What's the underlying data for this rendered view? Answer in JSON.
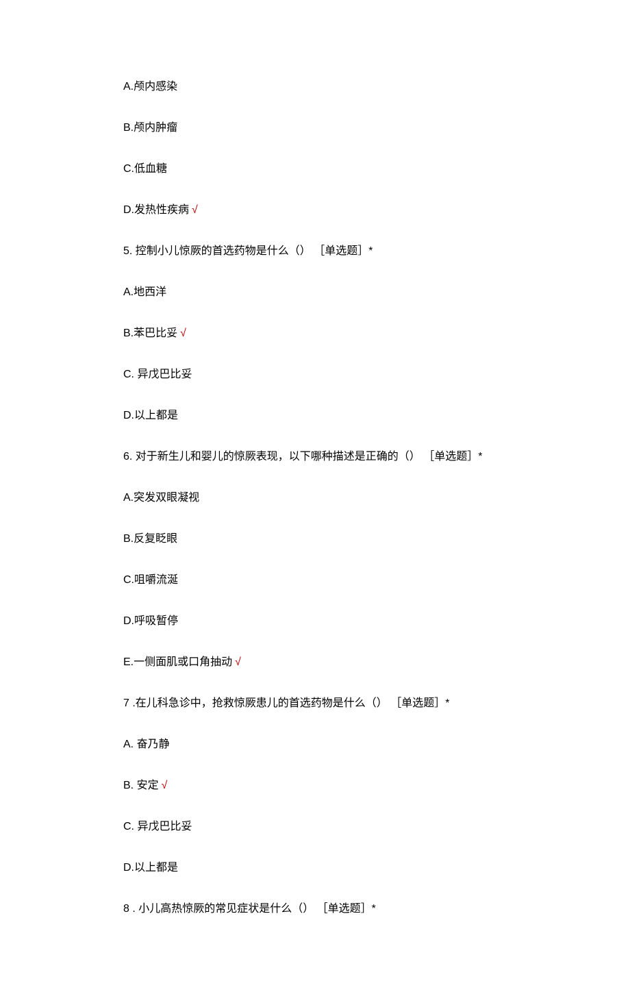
{
  "q4": {
    "optA": "A.颅内感染",
    "optB": "B.颅内肿瘤",
    "optC": "C.低血糖",
    "optD": "D.发热性疾病",
    "mark": "√"
  },
  "q5": {
    "stem": "5. 控制小儿惊厥的首选药物是什么（） ［单选题］*",
    "optA": "A.地西洋",
    "optB": "B.苯巴比妥",
    "markB": "√",
    "optC": "C. 异戊巴比妥",
    "optD": "D.以上都是"
  },
  "q6": {
    "stem": "6. 对于新生儿和婴儿的惊厥表现，以下哪种描述是正确的（） ［单选题］*",
    "optA": "A.突发双眼凝视",
    "optB": "B.反复眨眼",
    "optC": "C.咀嚼流涎",
    "optD": "D.呼吸暂停",
    "optE": "E.一侧面肌或口角抽动",
    "markE": "√"
  },
  "q7": {
    "stem": "7  .在儿科急诊中，抢救惊厥患儿的首选药物是什么（） ［单选题］*",
    "optA": "A. 奋乃静",
    "optB": "B. 安定",
    "markB": "√",
    "optC": "C. 异戊巴比妥",
    "optD": "D.以上都是"
  },
  "q8": {
    "stem": "8  . 小儿高热惊厥的常见症状是什么（） ［单选题］*"
  }
}
